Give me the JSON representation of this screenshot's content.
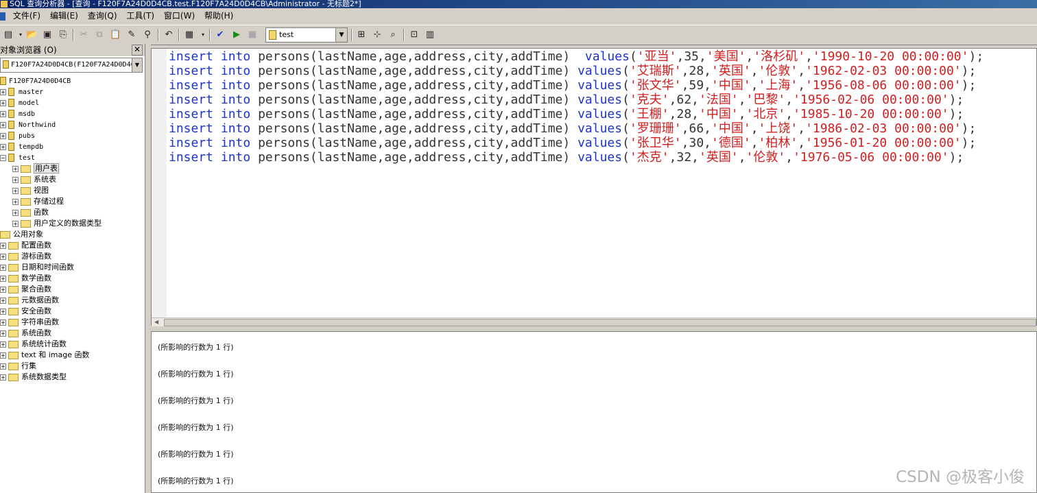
{
  "window": {
    "title": "SQL 查询分析器 - [查询 - F120F7A24D0D4CB.test.F120F7A24D0D4CB\\Administrator - 无标题2*]"
  },
  "menu": [
    "文件(F)",
    "编辑(E)",
    "查询(Q)",
    "工具(T)",
    "窗口(W)",
    "帮助(H)"
  ],
  "toolbar": {
    "database": "test"
  },
  "object_browser": {
    "title": "对象浏览器 (O)",
    "server_combo": "F120F7A24D0D4CB(F120F7A24D0D4C",
    "root": "F120F7A24D0D4CB",
    "databases": [
      "master",
      "model",
      "msdb",
      "Northwind",
      "pubs",
      "tempdb",
      "test"
    ],
    "test_children": [
      "用户表",
      "系统表",
      "视图",
      "存储过程",
      "函数",
      "用户定义的数据类型"
    ],
    "common_objects": "公用对象",
    "common_children": [
      "配置函数",
      "游标函数",
      "日期和时间函数",
      "数学函数",
      "聚合函数",
      "元数据函数",
      "安全函数",
      "字符串函数",
      "系统函数",
      "系统统计函数",
      "text 和 image 函数",
      "行集",
      "系统数据类型"
    ]
  },
  "editor": {
    "kw_insert": "insert",
    "kw_into": "into",
    "table_cols": "persons(lastName,age,address,city,addTime)",
    "kw_values": "values",
    "rows": [
      {
        "name": "亚当",
        "age": "35",
        "address": "美国",
        "city": "洛杉矶",
        "time": "1990-10-20 00:00:00"
      },
      {
        "name": "艾瑞斯",
        "age": "28",
        "address": "英国",
        "city": "伦敦",
        "time": "1962-02-03 00:00:00"
      },
      {
        "name": "张文华",
        "age": "59",
        "address": "中国",
        "city": "上海",
        "time": "1956-08-06 00:00:00"
      },
      {
        "name": "克夫",
        "age": "62",
        "address": "法国",
        "city": "巴黎",
        "time": "1956-02-06 00:00:00"
      },
      {
        "name": "王棚",
        "age": "28",
        "address": "中国",
        "city": "北京",
        "time": "1985-10-20 00:00:00"
      },
      {
        "name": "罗珊珊",
        "age": "66",
        "address": "中国",
        "city": "上饶",
        "time": "1986-02-03 00:00:00"
      },
      {
        "name": "张卫华",
        "age": "30",
        "address": "德国",
        "city": "柏林",
        "time": "1956-01-20 00:00:00"
      },
      {
        "name": "杰克",
        "age": "32",
        "address": "英国",
        "city": "伦敦",
        "time": "1976-05-06 00:00:00"
      }
    ]
  },
  "results": {
    "lines": [
      "(所影响的行数为 1 行)",
      "(所影响的行数为 1 行)",
      "(所影响的行数为 1 行)",
      "(所影响的行数为 1 行)",
      "(所影响的行数为 1 行)",
      "(所影响的行数为 1 行)"
    ]
  },
  "watermark": "CSDN @极客小俊"
}
